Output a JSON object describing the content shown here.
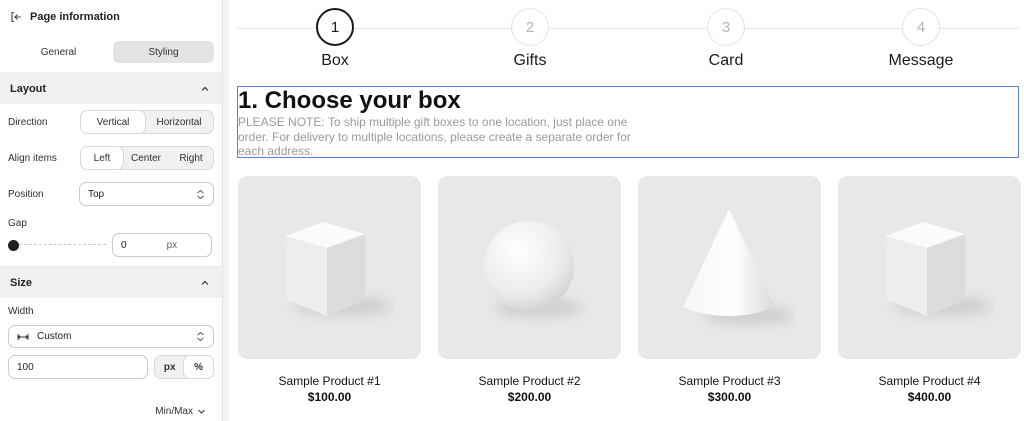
{
  "panel": {
    "title": "Page information",
    "tabs": [
      "General",
      "Styling"
    ],
    "active_tab": "Styling",
    "layout": {
      "heading": "Layout",
      "direction": {
        "label": "Direction",
        "options": [
          "Vertical",
          "Horizontal"
        ],
        "selected": "Vertical"
      },
      "align_items": {
        "label": "Align items",
        "options": [
          "Left",
          "Center",
          "Right"
        ],
        "selected": "Left"
      },
      "position": {
        "label": "Position",
        "value": "Top"
      },
      "gap": {
        "label": "Gap",
        "value": "0",
        "unit": "px",
        "slider_fraction": 0
      }
    },
    "size": {
      "heading": "Size",
      "width": {
        "label": "Width",
        "mode": "Custom",
        "value": "100",
        "units": [
          "px",
          "%"
        ],
        "selected_unit": "%"
      },
      "minmax_label": "Min/Max"
    }
  },
  "preview": {
    "steps": [
      {
        "number": "1",
        "label": "Box",
        "active": true
      },
      {
        "number": "2",
        "label": "Gifts",
        "active": false
      },
      {
        "number": "3",
        "label": "Card",
        "active": false
      },
      {
        "number": "4",
        "label": "Message",
        "active": false
      }
    ],
    "heading": "1. Choose your box",
    "note": "PLEASE NOTE: To ship multiple gift boxes to one location, just place one order. For delivery to multiple locations, please create a separate order for each address.",
    "products": [
      {
        "name": "Sample Product #1",
        "price": "$100.00",
        "shape": "cube"
      },
      {
        "name": "Sample Product #2",
        "price": "$200.00",
        "shape": "sphere"
      },
      {
        "name": "Sample Product #3",
        "price": "$300.00",
        "shape": "cone"
      },
      {
        "name": "Sample Product #4",
        "price": "$400.00",
        "shape": "cube"
      }
    ]
  },
  "colors": {
    "selection_outline": "#5b7fe0",
    "thumb_bg": "#e8e8e8",
    "panel_section_bg": "#f1f1f1"
  }
}
